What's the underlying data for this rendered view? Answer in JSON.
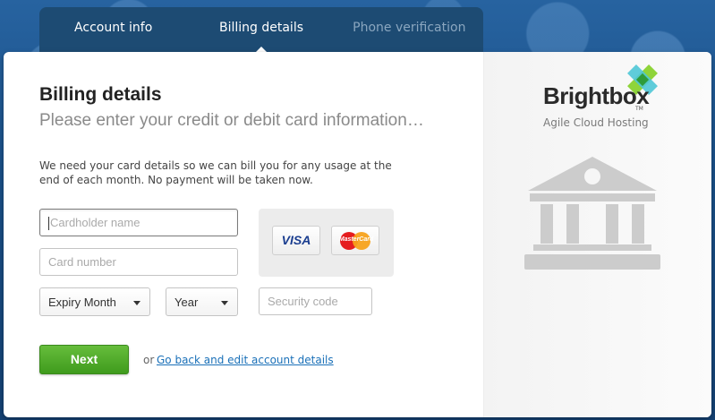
{
  "tabs": [
    {
      "label": "Account info",
      "state": "normal"
    },
    {
      "label": "Billing details",
      "state": "active"
    },
    {
      "label": "Phone verification",
      "state": "disabled"
    }
  ],
  "form": {
    "title": "Billing details",
    "subtitle": "Please enter your credit or debit card information…",
    "notice": "We need your card details so we can bill you for any usage at the end of each month. No payment will be taken now.",
    "cardholder_placeholder": "Cardholder name",
    "card_number_placeholder": "Card number",
    "expiry_month": "Expiry Month",
    "expiry_year": "Year",
    "security_code_placeholder": "Security code",
    "next_label": "Next",
    "or_text": "or",
    "back_link": "Go back and edit account details"
  },
  "payment_cards": {
    "visa": "VISA",
    "mastercard": "MasterCard"
  },
  "brand": {
    "name": "Brightbox",
    "trademark": "TM",
    "tagline": "Agile Cloud Hosting"
  },
  "icons": {
    "bank": "bank-building-icon",
    "logo": "brightbox-logo-icon"
  },
  "colors": {
    "background": "#17497a",
    "tab_bar": "#1d4b73",
    "next_button": "#4fa828",
    "link": "#1a70b8",
    "bank_icon": "#cccccc"
  }
}
